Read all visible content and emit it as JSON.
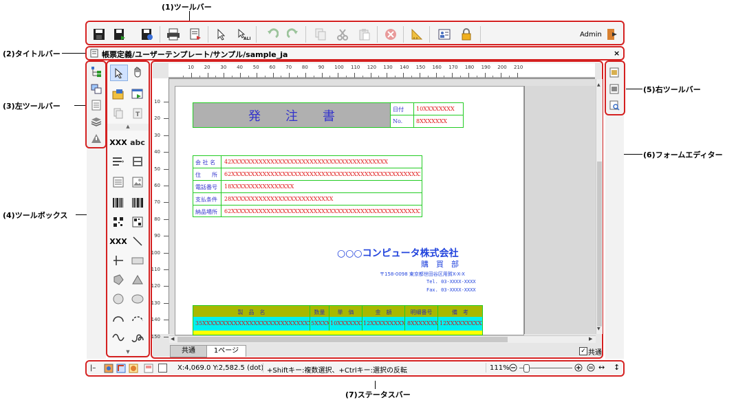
{
  "callouts": {
    "toolbar": "(1)ツールバー",
    "titlebar": "(2)タイトルバー",
    "left_toolbar": "(3)左ツールバー",
    "toolbox": "(4)ツールボックス",
    "right_toolbar": "(5)右ツールバー",
    "form_editor": "(6)フォームエディター",
    "statusbar": "(7)ステータスバー"
  },
  "toolbar": {
    "user": "Admin",
    "icons": [
      "save-icon",
      "save-as-icon",
      "save-history-icon",
      "print-icon",
      "print-settings-icon",
      "select-icon",
      "select-all-icon",
      "undo-icon",
      "redo-icon",
      "copy-icon",
      "cut-icon",
      "paste-icon",
      "delete-icon",
      "grid-icon",
      "properties-icon",
      "lock-icon"
    ]
  },
  "titlebar": {
    "path": "帳票定義/ユーザーテンプレート/サンプル/sample_ja",
    "close": "×"
  },
  "ruler": {
    "h_ticks": [
      "10",
      "20",
      "30",
      "40",
      "50",
      "60",
      "70",
      "80",
      "90",
      "100",
      "110",
      "120",
      "130",
      "140",
      "150",
      "160",
      "170",
      "180",
      "190",
      "200",
      "210"
    ],
    "v_ticks": [
      "10",
      "20",
      "30",
      "40",
      "50",
      "60",
      "70",
      "80",
      "90",
      "100",
      "110",
      "120",
      "130",
      "140",
      "150"
    ]
  },
  "toolbox": {
    "text_tool": "XXX",
    "abc_tool": "abc",
    "multi_tool": "XXX"
  },
  "form": {
    "title": "発　　注　　書",
    "date_label": "日付",
    "date_value": "10XXXXXXXX",
    "no_label": "No.",
    "no_value": "8XXXXXXX",
    "rows": [
      {
        "label": "会 社 名",
        "value": "42XXXXXXXXXXXXXXXXXXXXXXXXXXXXXXXXXXXXXXXX"
      },
      {
        "label": "住　　所",
        "value": "62XXXXXXXXXXXXXXXXXXXXXXXXXXXXXXXXXXXXXXXXXXXXXXXXXXXXXXXXXXXXXX"
      },
      {
        "label": "電話番号",
        "value": "18XXXXXXXXXXXXXXXX"
      },
      {
        "label": "支払条件",
        "value": "28XXXXXXXXXXXXXXXXXXXXXXXXXX"
      },
      {
        "label": "納品場所",
        "value": "62XXXXXXXXXXXXXXXXXXXXXXXXXXXXXXXXXXXXXXXXXXXXXXXXXXXXXXXXXXXXXX"
      }
    ],
    "company": "○○○コンピュータ株式会社",
    "dept": "購　買　部",
    "address": "〒158-0098 東京都世田谷区用賀X-X-X",
    "tel": "Tel. 03-XXXX-XXXX",
    "fax": "Fax. 03-XXXX-XXXX",
    "table_headers": [
      "製　品　名",
      "数量",
      "単　価",
      "金　額",
      "明細番号",
      "備　考"
    ],
    "table_row": [
      "35XXXXXXXXXXXXXXXXXXXXXXXXXXXXXXXXXX",
      "5XXXX",
      "10XXXXXXXX",
      "12XXXXXXXXXX",
      "8XXXXXXX",
      "12XXXXXXXXXX"
    ]
  },
  "tabs": {
    "common": "共通",
    "page1": "1ページ",
    "common_check": "共通"
  },
  "statusbar": {
    "coords": "X:4,069.0 Y:2,582.5 (dot)",
    "hint": "+Shiftキー:複数選択、+Ctrlキー:選択の反転",
    "zoom": "111%"
  },
  "colors": {
    "callout_border": "#d42020",
    "form_border": "#22cc22",
    "form_text": "#e01010",
    "form_label": "#3333cc",
    "title_bg": "#b0b0b0",
    "header_bg": "#a8b800",
    "row_bg": "#00f0f0",
    "yellow_row": "#ffff00"
  }
}
